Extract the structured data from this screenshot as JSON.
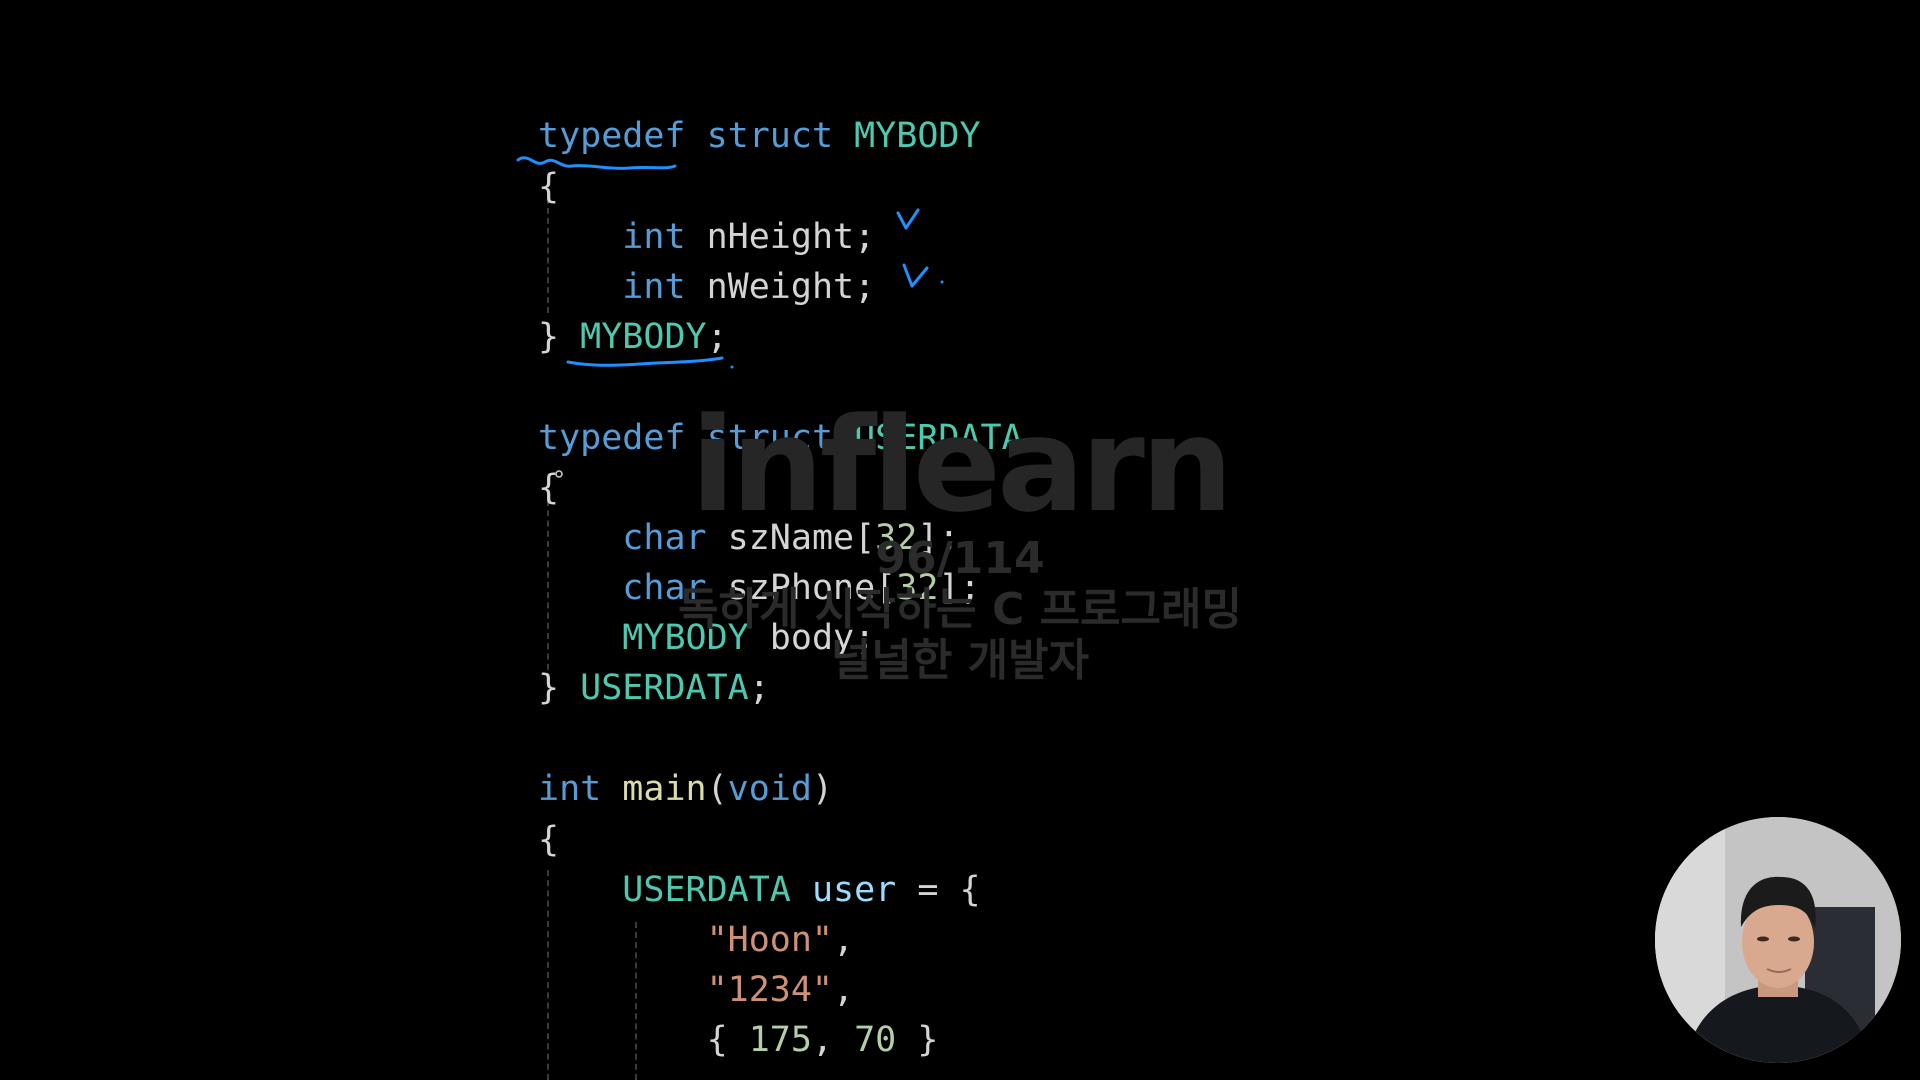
{
  "colors": {
    "keyword": "#569cd6",
    "type": "#4ec9b0",
    "plain": "#d4d4d4",
    "function": "#dcdcaa",
    "string": "#ce9178",
    "number": "#b5cea8",
    "variable": "#9cdcfe",
    "annotation": "#1e90ff",
    "watermark": "#2b2b2b"
  },
  "code": {
    "lines": [
      {
        "tokens": [
          {
            "t": "typedef",
            "c": "keyword"
          },
          {
            "t": " ",
            "c": "plain"
          },
          {
            "t": "struct",
            "c": "keyword"
          },
          {
            "t": " ",
            "c": "plain"
          },
          {
            "t": "MYBODY",
            "c": "type"
          }
        ]
      },
      {
        "tokens": [
          {
            "t": "{",
            "c": "plain"
          }
        ]
      },
      {
        "tokens": [
          {
            "t": "    ",
            "c": "plain"
          },
          {
            "t": "int",
            "c": "keyword"
          },
          {
            "t": " nHeight;",
            "c": "plain"
          }
        ]
      },
      {
        "tokens": [
          {
            "t": "    ",
            "c": "plain"
          },
          {
            "t": "int",
            "c": "keyword"
          },
          {
            "t": " nWeight;",
            "c": "plain"
          }
        ]
      },
      {
        "tokens": [
          {
            "t": "} ",
            "c": "plain"
          },
          {
            "t": "MYBODY",
            "c": "type"
          },
          {
            "t": ";",
            "c": "plain"
          }
        ]
      },
      {
        "tokens": []
      },
      {
        "tokens": [
          {
            "t": "typedef",
            "c": "keyword"
          },
          {
            "t": " ",
            "c": "plain"
          },
          {
            "t": "struct",
            "c": "keyword"
          },
          {
            "t": " ",
            "c": "plain"
          },
          {
            "t": "USERDATA",
            "c": "type"
          }
        ]
      },
      {
        "tokens": [
          {
            "t": "{",
            "c": "plain"
          }
        ]
      },
      {
        "tokens": [
          {
            "t": "    ",
            "c": "plain"
          },
          {
            "t": "char",
            "c": "keyword"
          },
          {
            "t": " szName[",
            "c": "plain"
          },
          {
            "t": "32",
            "c": "number"
          },
          {
            "t": "];",
            "c": "plain"
          }
        ]
      },
      {
        "tokens": [
          {
            "t": "    ",
            "c": "plain"
          },
          {
            "t": "char",
            "c": "keyword"
          },
          {
            "t": " szPhone[",
            "c": "plain"
          },
          {
            "t": "32",
            "c": "number"
          },
          {
            "t": "];",
            "c": "plain"
          }
        ]
      },
      {
        "tokens": [
          {
            "t": "    ",
            "c": "plain"
          },
          {
            "t": "MYBODY",
            "c": "type"
          },
          {
            "t": " body;",
            "c": "plain"
          }
        ]
      },
      {
        "tokens": [
          {
            "t": "} ",
            "c": "plain"
          },
          {
            "t": "USERDATA",
            "c": "type"
          },
          {
            "t": ";",
            "c": "plain"
          }
        ]
      },
      {
        "tokens": []
      },
      {
        "tokens": [
          {
            "t": "int",
            "c": "keyword"
          },
          {
            "t": " ",
            "c": "plain"
          },
          {
            "t": "main",
            "c": "function"
          },
          {
            "t": "(",
            "c": "plain"
          },
          {
            "t": "void",
            "c": "keyword"
          },
          {
            "t": ")",
            "c": "plain"
          }
        ]
      },
      {
        "tokens": [
          {
            "t": "{",
            "c": "plain"
          }
        ]
      },
      {
        "tokens": [
          {
            "t": "    ",
            "c": "plain"
          },
          {
            "t": "USERDATA",
            "c": "type"
          },
          {
            "t": " ",
            "c": "plain"
          },
          {
            "t": "user",
            "c": "variable"
          },
          {
            "t": " = {",
            "c": "plain"
          }
        ]
      },
      {
        "tokens": [
          {
            "t": "        ",
            "c": "plain"
          },
          {
            "t": "\"Hoon\"",
            "c": "string"
          },
          {
            "t": ",",
            "c": "plain"
          }
        ]
      },
      {
        "tokens": [
          {
            "t": "        ",
            "c": "plain"
          },
          {
            "t": "\"1234\"",
            "c": "string"
          },
          {
            "t": ",",
            "c": "plain"
          }
        ]
      },
      {
        "tokens": [
          {
            "t": "        { ",
            "c": "plain"
          },
          {
            "t": "175",
            "c": "number"
          },
          {
            "t": ", ",
            "c": "plain"
          },
          {
            "t": "70",
            "c": "number"
          },
          {
            "t": " }",
            "c": "plain"
          }
        ]
      }
    ]
  },
  "watermark": {
    "logo": "inflearn",
    "id": "96/114",
    "course": "독하게 시작하는 C 프로그래밍",
    "author": "널널한 개발자"
  },
  "webcam": {
    "icon": "presenter-webcam"
  }
}
